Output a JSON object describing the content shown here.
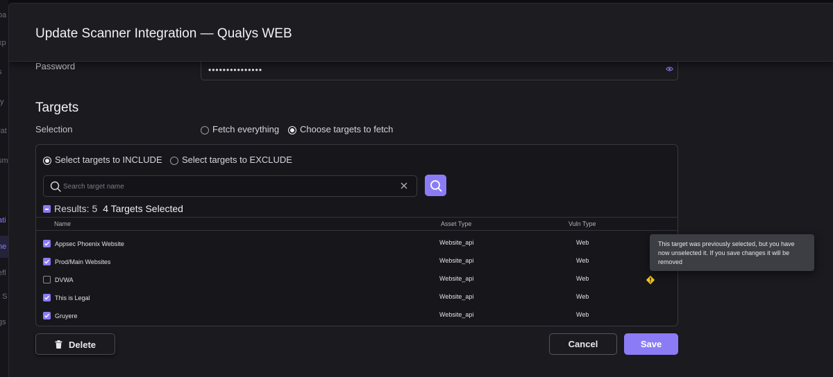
{
  "background": {
    "sidebar_fragments": [
      "oa",
      "xp",
      "s",
      "ty",
      "rat",
      "sm",
      "",
      "ati",
      "ne",
      "efl",
      "t S",
      "gs"
    ]
  },
  "modal": {
    "title": "Update Scanner Integration — Qualys WEB",
    "password": {
      "label": "Password",
      "value": "•••••••••••••••"
    },
    "targets": {
      "heading": "Targets",
      "selection_label": "Selection",
      "fetch_options": [
        {
          "label": "Fetch everything",
          "checked": false
        },
        {
          "label": "Choose targets to fetch",
          "checked": true
        }
      ],
      "mode_options": [
        {
          "label": "Select targets to INCLUDE",
          "checked": true
        },
        {
          "label": "Select targets to EXCLUDE",
          "checked": false
        }
      ],
      "search": {
        "placeholder": "Search target name",
        "value": ""
      },
      "results_label": "Results: 5",
      "selected_label": "4 Targets Selected",
      "columns": [
        "Name",
        "Asset Type",
        "Vuln Type"
      ],
      "rows": [
        {
          "name": "Appsec Phoenix Website",
          "asset_type": "Website_api",
          "vuln_type": "Web",
          "checked": true
        },
        {
          "name": "Prod/Main Websites",
          "asset_type": "Website_api",
          "vuln_type": "Web",
          "checked": true
        },
        {
          "name": "DVWA",
          "asset_type": "Website_api",
          "vuln_type": "Web",
          "checked": false,
          "warning": true
        },
        {
          "name": "This is Legal",
          "asset_type": "Website_api",
          "vuln_type": "Web",
          "checked": true
        },
        {
          "name": "Gruyere",
          "asset_type": "Website_api",
          "vuln_type": "Web",
          "checked": true
        }
      ],
      "tooltip": "This target was previously selected, but you have now unselected it. If you save changes it will be removed"
    },
    "buttons": {
      "delete": "Delete",
      "cancel": "Cancel",
      "save": "Save"
    }
  },
  "colors": {
    "accent": "#8b7cf6",
    "warning": "#f5c518"
  }
}
